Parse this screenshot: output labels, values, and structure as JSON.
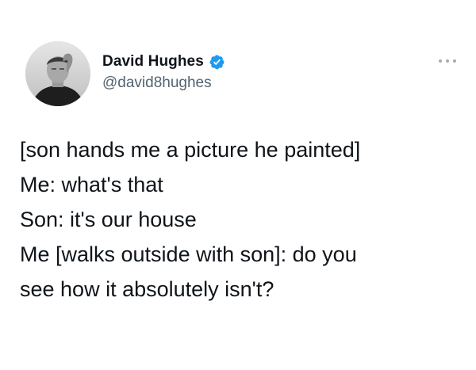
{
  "author": {
    "display_name": "David Hughes",
    "handle": "@david8hughes",
    "verified": true,
    "verified_color": "#1d9bf0"
  },
  "tweet": {
    "lines": [
      "[son hands me a picture he painted]",
      "Me: what's that",
      "Son: it's our house",
      "Me [walks outside with son]: do you",
      "see how it absolutely isn't?"
    ]
  },
  "icons": {
    "more": "more-options-icon",
    "verified": "verified-badge-icon"
  }
}
